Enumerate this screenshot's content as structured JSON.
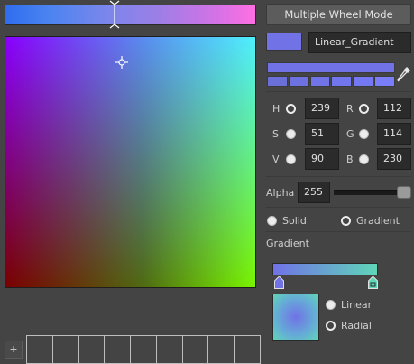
{
  "colors": {
    "current": "#7072E6",
    "hue_strip_left": "#2F6DF0",
    "hue_strip_right": "#FF6FE3",
    "gradient_end": "#5FD6B8",
    "shades": [
      "#6B70D8",
      "#6D72E0",
      "#7074E6",
      "#7276EC",
      "#7478F2",
      "#7A7EF8"
    ]
  },
  "header": {
    "mode_button_label": "Multiple Wheel Mode",
    "gradient_name": "Linear_Gradient"
  },
  "hsv": {
    "h_label": "H",
    "h_value": "239",
    "s_label": "S",
    "s_value": "51",
    "v_label": "V",
    "v_value": "90"
  },
  "rgb": {
    "r_label": "R",
    "r_value": "112",
    "g_label": "G",
    "g_value": "114",
    "b_label": "B",
    "b_value": "230"
  },
  "alpha": {
    "label": "Alpha",
    "value": "255",
    "level": 1.0
  },
  "fill_type": {
    "solid_label": "Solid",
    "gradient_label": "Gradient",
    "selected": "Gradient"
  },
  "gradient": {
    "section_label": "Gradient",
    "linear_label": "Linear",
    "radial_label": "Radial",
    "selected": "Radial"
  },
  "swatches": {
    "add_label": "+",
    "columns": 9,
    "rows": 2
  },
  "icons": {
    "hue_marker": "hue-marker-icon",
    "picker_cursor": "crosshair-icon",
    "eyedropper": "eyedropper-icon",
    "gradient_stop": "gradient-stop-icon"
  }
}
